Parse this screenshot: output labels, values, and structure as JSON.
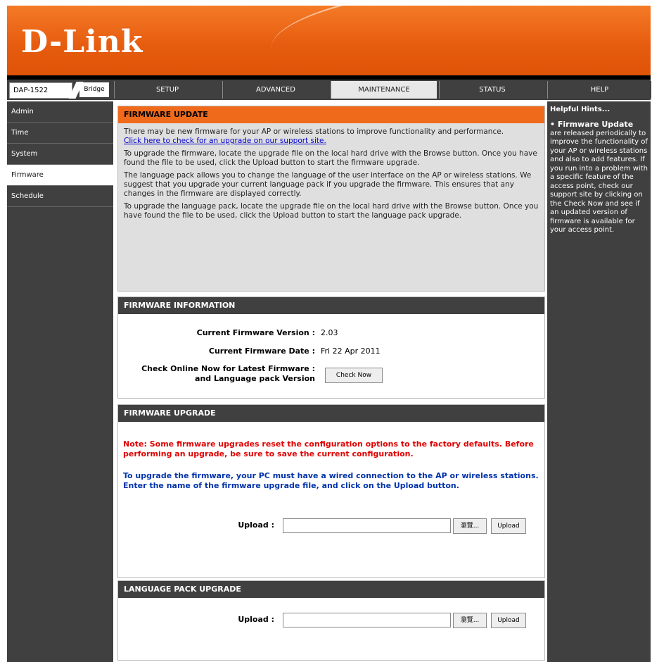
{
  "header": {
    "logo": "D-Link"
  },
  "topbar": {
    "model": "DAP-1522",
    "mode": "Bridge"
  },
  "tabs": [
    {
      "label": "SETUP"
    },
    {
      "label": "ADVANCED"
    },
    {
      "label": "MAINTENANCE"
    },
    {
      "label": "STATUS"
    },
    {
      "label": "HELP"
    }
  ],
  "sidebar": {
    "items": [
      {
        "label": "Admin"
      },
      {
        "label": "Time"
      },
      {
        "label": "System"
      },
      {
        "label": "Firmware"
      },
      {
        "label": "Schedule"
      }
    ]
  },
  "firmware_update": {
    "title": "FIRMWARE UPDATE",
    "p1": "There may be new firmware for your AP or wireless stations to improve functionality and performance.",
    "link": "Click here to check for an upgrade on our support site.",
    "p2": "To upgrade the firmware, locate the upgrade file on the local hard drive with the Browse button. Once you have found the file to be used, click the Upload button to start the firmware upgrade.",
    "p3": "The language pack allows you to change the language of the user interface on the AP or wireless stations. We suggest that you upgrade your current language pack if you upgrade the firmware. This ensures that any changes in the firmware are displayed correctly.",
    "p4": "To upgrade the language pack, locate the upgrade file on the local hard drive with the Browse button. Once you have found the file to be used, click the Upload button to start the language pack upgrade."
  },
  "firmware_info": {
    "title": "FIRMWARE INFORMATION",
    "version_label": "Current Firmware Version :",
    "version_value": "2.03",
    "date_label": "Current Firmware Date :",
    "date_value": "Fri 22 Apr 2011",
    "check_label_1": "Check Online Now for Latest Firmware :",
    "check_label_2": "and Language pack Version",
    "check_button": "Check Now"
  },
  "firmware_upgrade": {
    "title": "FIRMWARE UPGRADE",
    "note": "Note: Some firmware upgrades reset the configuration options to the factory defaults. Before performing an upgrade, be sure to save the current configuration.",
    "instructions": "To upgrade the firmware, your PC must have a wired connection to the AP or wireless stations. Enter the name of the firmware upgrade file, and click on the Upload button.",
    "upload_label": "Upload :",
    "browse_button": "瀏覽...",
    "upload_button": "Upload"
  },
  "language_pack": {
    "title": "LANGUAGE PACK UPGRADE",
    "upload_label": "Upload :",
    "browse_button": "瀏覽...",
    "upload_button": "Upload"
  },
  "help": {
    "title": "Helpful Hints...",
    "heading": "• Firmware Update",
    "text": "are released periodically to improve the functionality of your AP or wireless stations and also to add features. If you run into a problem with a specific feature of the access point, check our support site by clicking on the Check Now and see if an updated version of firmware is available for your access point."
  }
}
